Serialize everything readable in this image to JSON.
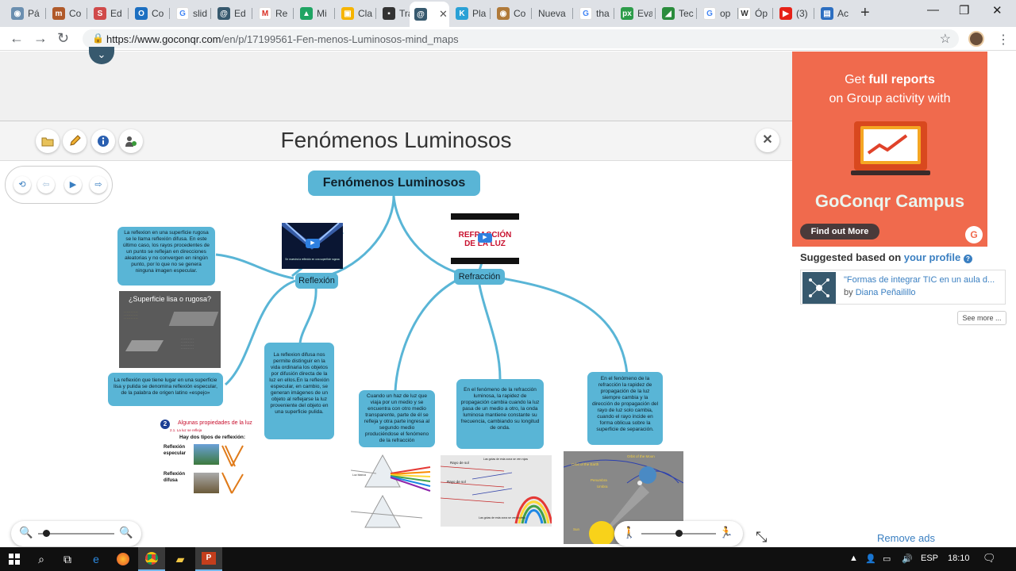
{
  "browser": {
    "tabs": [
      {
        "label": "Pá",
        "icon": "web-icon",
        "color": "#6b8fb0"
      },
      {
        "label": "Co",
        "icon": "mcafee-icon",
        "color": "#b05a2a"
      },
      {
        "label": "Ed",
        "icon": "s-icon",
        "color": "#d04a4a"
      },
      {
        "label": "Co",
        "icon": "outlook-icon",
        "color": "#1c6fc1"
      },
      {
        "label": "slid",
        "icon": "google-icon",
        "color": "#4285f4"
      },
      {
        "label": "Ed",
        "icon": "goconqr-icon",
        "color": "#37596e"
      },
      {
        "label": "Re",
        "icon": "gmail-icon",
        "color": "#d93025"
      },
      {
        "label": "Mi",
        "icon": "drive-icon",
        "color": "#1fa463"
      },
      {
        "label": "Cla",
        "icon": "classroom-icon",
        "color": "#f6b400"
      },
      {
        "label": "Tra",
        "icon": "slides-icon",
        "color": "#333333"
      },
      {
        "label": "",
        "icon": "goconqr-icon",
        "color": "#37596e",
        "active": true
      },
      {
        "label": "Pla",
        "icon": "k-icon",
        "color": "#2aa1d6"
      },
      {
        "label": "Co",
        "icon": "web-icon",
        "color": "#b07a3a"
      },
      {
        "label": "Nueva",
        "icon": "",
        "color": ""
      },
      {
        "label": "tha",
        "icon": "google-icon",
        "color": "#4285f4"
      },
      {
        "label": "Eva",
        "icon": "px-icon",
        "color": "#2d9c4a"
      },
      {
        "label": "Tec",
        "icon": "web-icon",
        "color": "#2a8c3c"
      },
      {
        "label": "op",
        "icon": "google-icon",
        "color": "#4285f4"
      },
      {
        "label": "Óp",
        "icon": "wikipedia-icon",
        "color": "#333333"
      },
      {
        "label": "(3)",
        "icon": "youtube-icon",
        "color": "#e62117"
      },
      {
        "label": "Ac",
        "icon": "web-icon",
        "color": "#2d6fc1"
      }
    ],
    "active_tab_close": "✕",
    "new_tab": "+",
    "window_controls": {
      "minimize": "—",
      "maximize": "❐",
      "close": "✕"
    },
    "url": {
      "base": "https://www.goconqr.com",
      "path": "/en/p/17199561-Fen-menos-Luminosos-mind_maps"
    }
  },
  "viewer": {
    "title": "Fenómenos Luminosos",
    "header_buttons": [
      "folder-icon",
      "pencil-icon",
      "info-icon",
      "share-icon"
    ],
    "close": "✕",
    "nav_buttons": [
      "refresh-icon",
      "prev-icon",
      "play-icon",
      "next-icon"
    ]
  },
  "mindmap": {
    "root": "Fenómenos Luminosos",
    "branches": {
      "reflexion": "Reflexión",
      "refraccion": "Refracción"
    },
    "bubbles": {
      "difusa": "La reflexion en una superficie rugosa se le llama reflexión difusa. En este último caso, los rayos procedentes de un punto se reflejan en direcciones aleatorias y no convergen en ningún punto, por lo que no se genera ninguna imagen especular.",
      "especular": "La reflexión que tiene lugar en una superficie lisa y pulida se denomina reflexión especular, de la palabra de origen latino «espejo»",
      "permite": "La reflexion difusa nos permite distinguir en la vida ordinaria los objetos por difusión directa de la luz en ellos.En la reflexión especular, en cambio, se generan imágenes de un objeto al reflejarse la luz proveniente del objeto en una superficie pulida.",
      "haz": "Cuando un haz de luz que viaja por un medio y se encuentra con otro medio transparente, parte de él se refleja y otra parte ingresa al segundo medio produciéndose el fenómeno de la refracción",
      "rapidez": "En el fenómeno de la refracción luminosa, la rapidez de propagación cambia cuando la luz pasa de un medio a otro, la onda luminosa mantiene constante su frecuencia, cambiando su longitud de onda.",
      "direccion": "En el fenómeno de la refracción la rapidez de propagación de la luz siempre cambia y la dirección de propagación del rayo de luz solo cambia, cuando el rayo incide en forma oblicua sobre la superficie de separación."
    },
    "images": {
      "video1_caption": "Se muestra la reflexión en una superficie rugosa",
      "refraccion_video_title": "REFRACCIÓN DE LA LUZ",
      "superficie_title": "¿Superficie lisa o rugosa?",
      "propiedades_num": "2",
      "propiedades_title": "Algunas propiedades de la luz",
      "propiedades_sub": "2.1. La luz se refleja",
      "tipos_title": "Hay dos tipos de reflexión:",
      "tipo1": "Reflexión especular",
      "tipo2": "Reflexión difusa",
      "prisma_luz": "Luz blanca",
      "rayo_sol1": "Rayo de sol",
      "rayo_sol2": "Rayo de sol",
      "gotas_roja": "Las gotas de esta zona se ven rojas",
      "gotas_violeta": "Las gotas de esta zona se ven violeta",
      "orbit_moon": "Orbit of the Moon",
      "orbit_earth": "Orbit of the Earth",
      "penumbra": "Penumbra",
      "umbra": "Umbra",
      "sun": "Sun"
    }
  },
  "controls": {
    "zoom_level": 0.1,
    "speed_level": 0.5
  },
  "sidebar": {
    "ad": {
      "line1_prefix": "Get ",
      "line1_bold": "full reports",
      "line2": "on Group activity with",
      "brand": "GoConqr Campus",
      "button": "Find out More",
      "logo": "G"
    },
    "suggested_prefix": "Suggested based on ",
    "suggested_link": "your profile",
    "card": {
      "title": "\"Formas de integrar TIC en un aula d...",
      "by": "by ",
      "author": "Diana Peñailillo"
    },
    "see_more": "See more ...",
    "remove_ads": "Remove ads"
  },
  "taskbar": {
    "lang": "ESP",
    "time": "18:10",
    "apps": [
      "windows-icon",
      "search-icon",
      "taskview-icon",
      "edge-icon",
      "firefox-icon",
      "chrome-icon",
      "explorer-icon",
      "powerpoint-icon"
    ]
  }
}
